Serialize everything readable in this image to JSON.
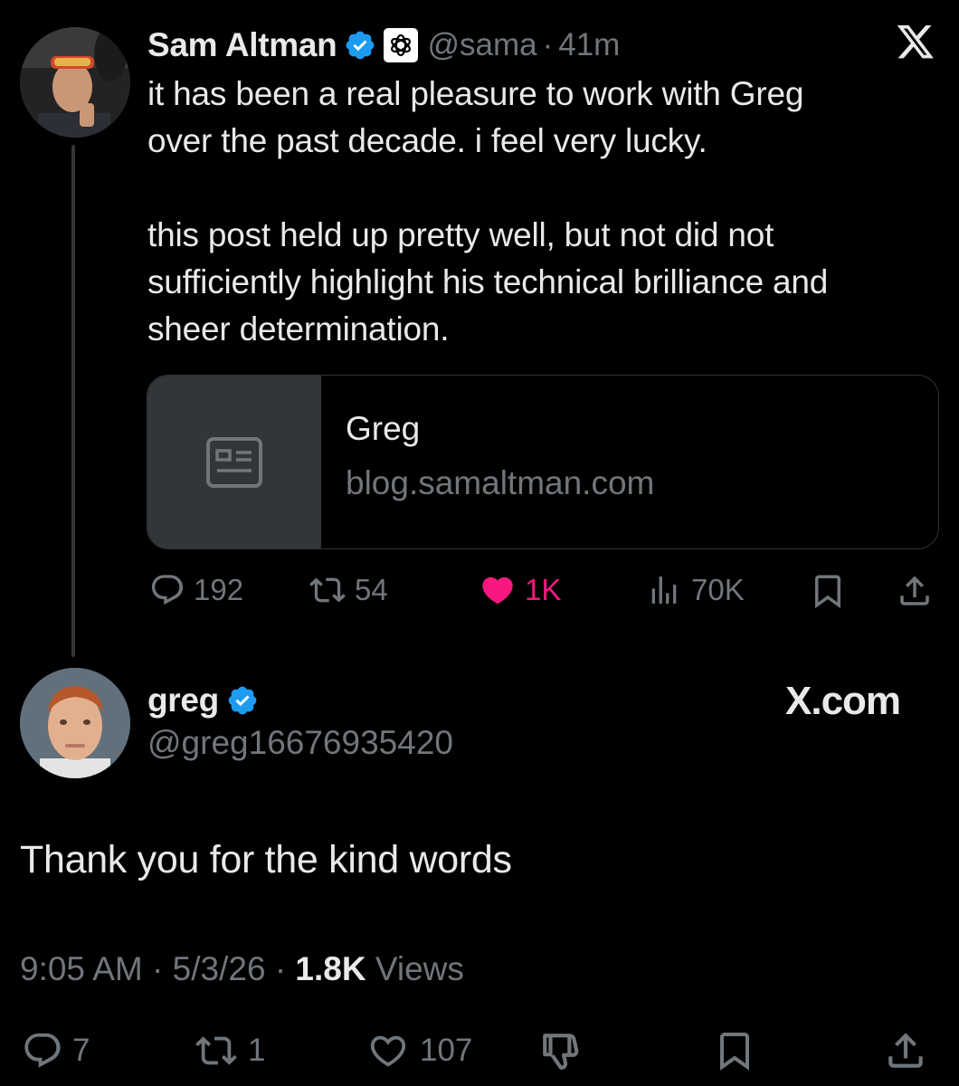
{
  "parent": {
    "name": "Sam Altman",
    "handle": "@sama",
    "separator": "·",
    "time": "41m",
    "text": "it has been a real pleasure to work with Greg\nover the past decade. i feel very lucky.\n\nthis post held up pretty well, but not did not\nsufficiently highlight his technical brilliance and\nsheer determination.",
    "link_card": {
      "title": "Greg",
      "domain": "blog.samaltman.com"
    },
    "actions": {
      "replies": "192",
      "reposts": "54",
      "likes": "1K",
      "views": "70K"
    },
    "icons": [
      "verified-badge-icon",
      "openai-affiliate-icon",
      "x-logo-icon",
      "article-icon",
      "reply-icon",
      "repost-icon",
      "heart-filled-icon",
      "views-icon",
      "bookmark-icon",
      "share-icon"
    ]
  },
  "reply": {
    "name": "greg",
    "handle": "@greg16676935420",
    "watermark": "X.com",
    "text": "Thank you for the kind words",
    "meta": {
      "time": "9:05 AM",
      "separator": "·",
      "date": "5/3/26",
      "views_count": "1.8K",
      "views_label": "Views"
    },
    "actions": {
      "replies": "7",
      "reposts": "1",
      "likes": "107"
    },
    "icons": [
      "verified-badge-icon",
      "reply-icon",
      "repost-icon",
      "heart-outline-icon",
      "dislike-icon",
      "bookmark-icon",
      "share-icon"
    ]
  },
  "colors": {
    "background": "#000000",
    "text": "#e7e9ea",
    "secondary_text": "#71767b",
    "verified_blue": "#1d9bf0",
    "like_pink": "#f91880",
    "border": "#2f3336"
  }
}
